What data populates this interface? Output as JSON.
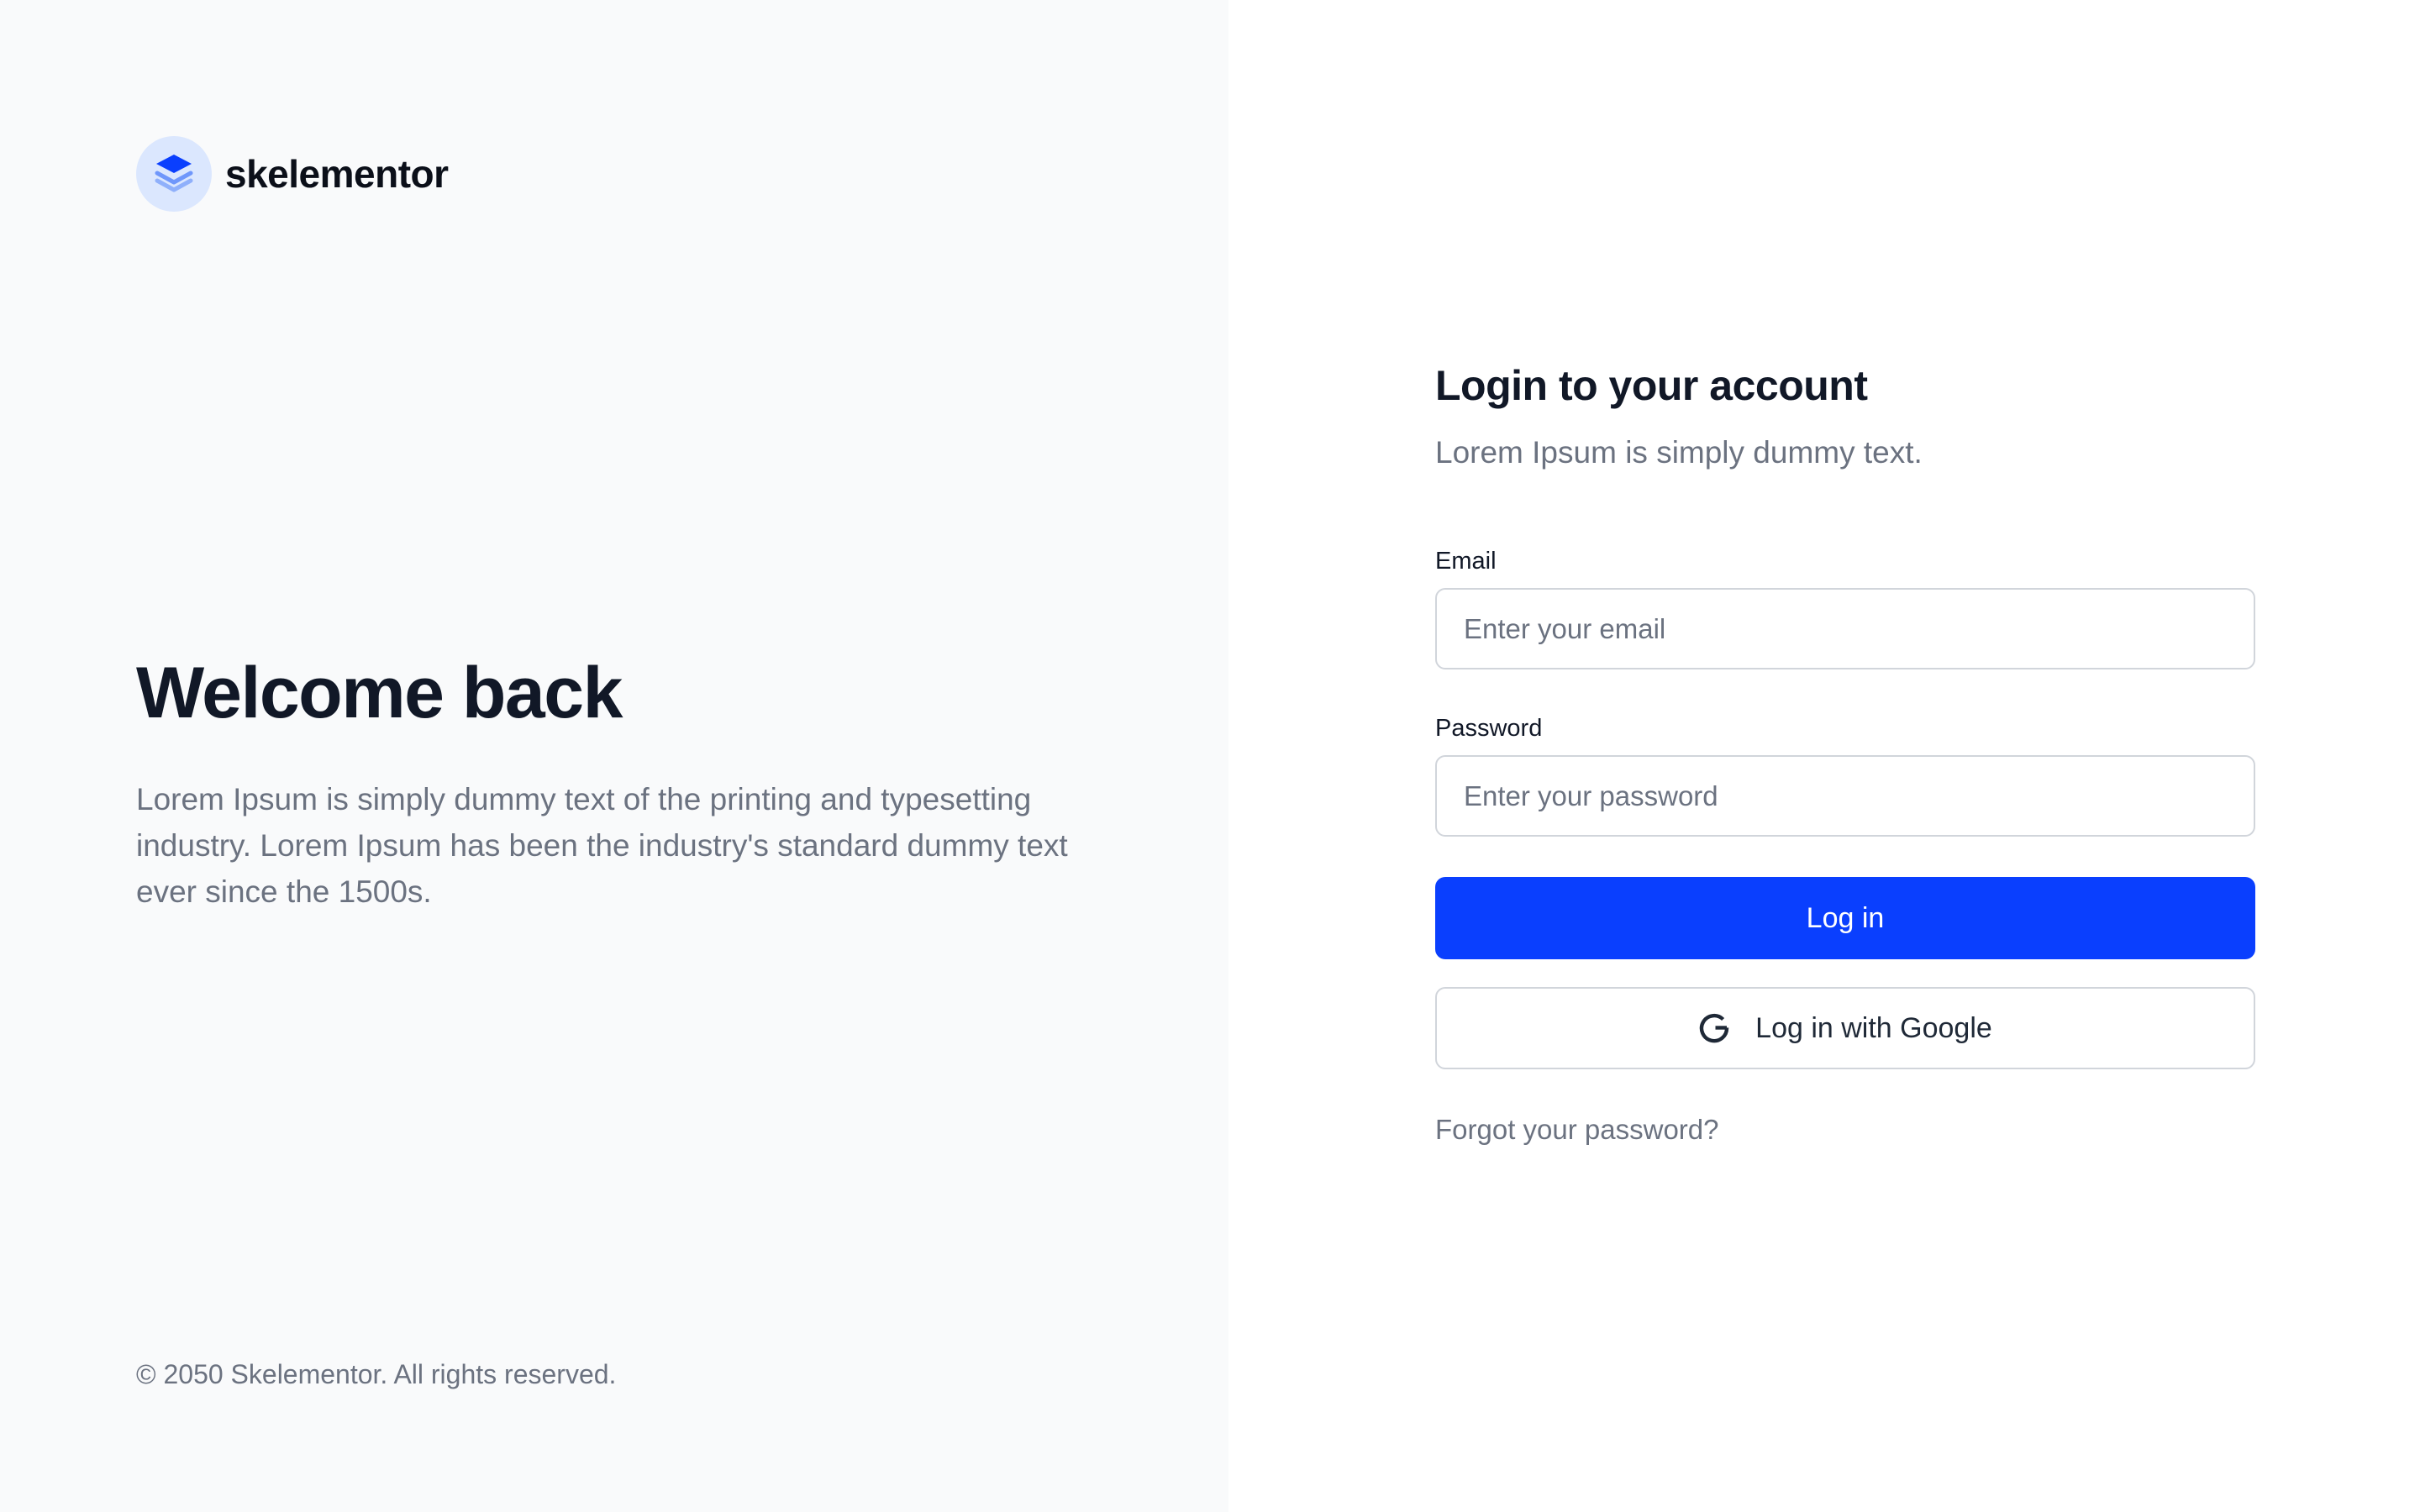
{
  "brand": {
    "name": "skelementor",
    "logo_icon": "stacked-layers-icon",
    "logo_bg_color": "#dbe7fe",
    "logo_color": "#0a3ffe"
  },
  "hero": {
    "title": "Welcome back",
    "text": "Lorem Ipsum is simply dummy text of the printing and typesetting industry. Lorem Ipsum has been the industry's standard dummy text ever since the 1500s."
  },
  "footer": {
    "copyright": "© 2050 Skelementor. All rights reserved."
  },
  "login": {
    "title": "Login to your account",
    "subtitle": "Lorem Ipsum is simply dummy text.",
    "email": {
      "label": "Email",
      "placeholder": "Enter your email",
      "value": ""
    },
    "password": {
      "label": "Password",
      "placeholder": "Enter your password",
      "value": ""
    },
    "login_button": "Log in",
    "google_button": "Log in with Google",
    "google_icon": "google-g-icon",
    "forgot_link": "Forgot your password?"
  },
  "colors": {
    "accent": "#0a3ffe",
    "left_panel_bg": "#f9fafb",
    "text_primary": "#111827",
    "text_muted": "#6b7280",
    "border": "#d1d5db"
  }
}
